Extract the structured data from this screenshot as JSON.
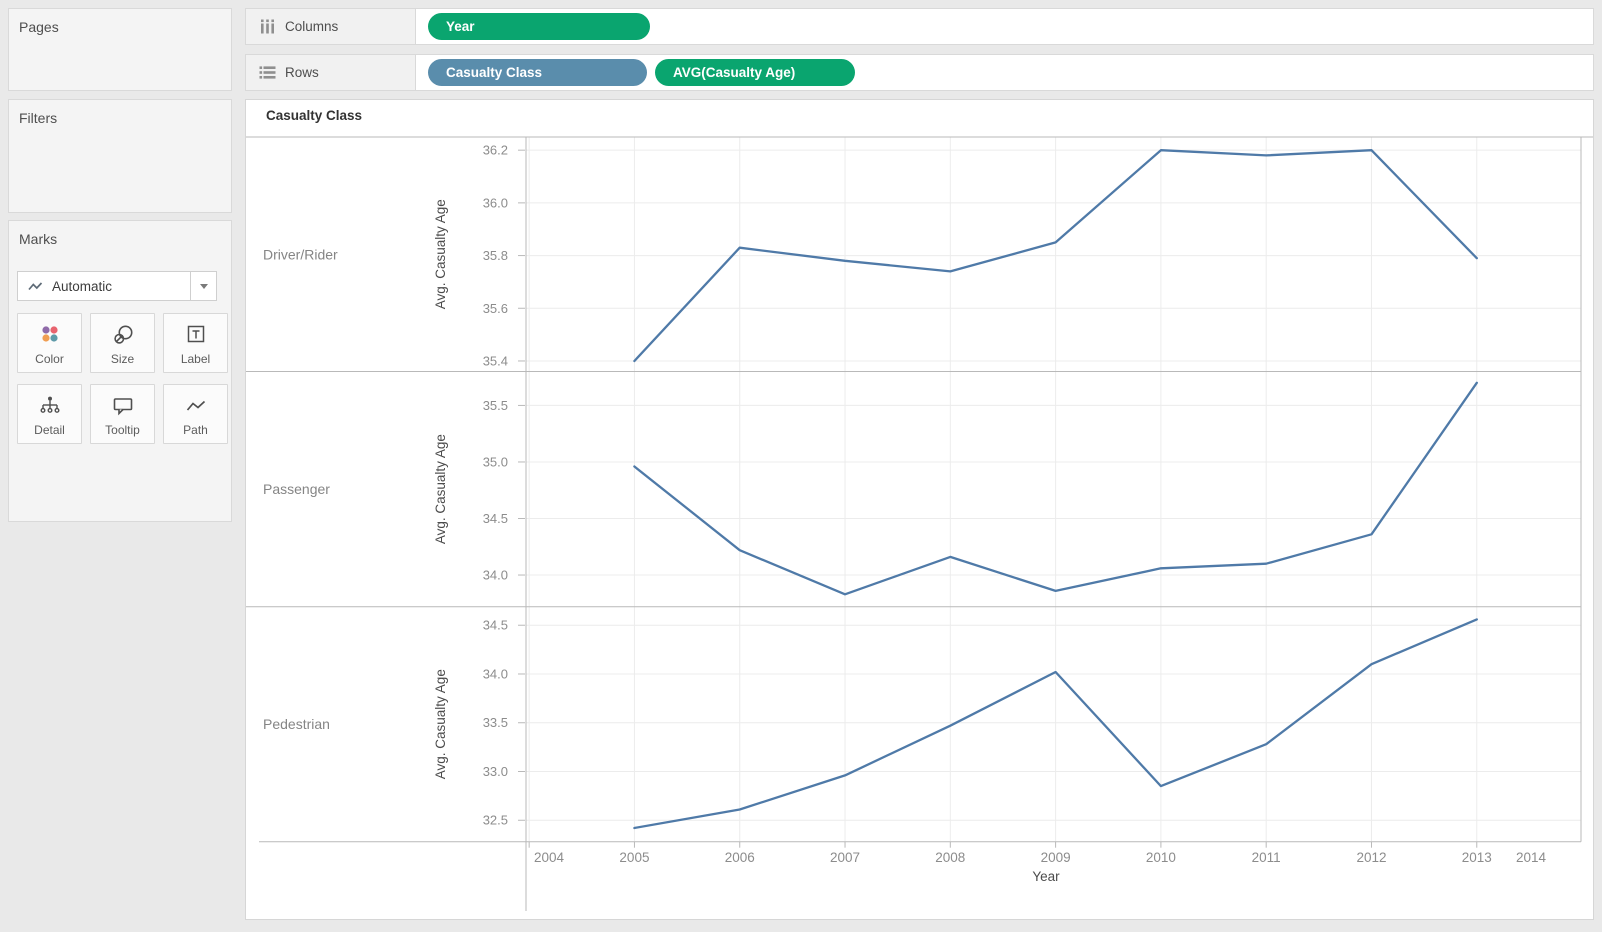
{
  "sidebar": {
    "pages": {
      "title": "Pages"
    },
    "filters": {
      "title": "Filters"
    },
    "marks": {
      "title": "Marks",
      "mark_type": {
        "label": "Automatic"
      },
      "buttons": [
        {
          "label": "Color"
        },
        {
          "label": "Size"
        },
        {
          "label": "Label"
        },
        {
          "label": "Detail"
        },
        {
          "label": "Tooltip"
        },
        {
          "label": "Path"
        }
      ],
      "color_icon_swatches": [
        "#8f6aa9",
        "#e8636e",
        "#f09e52",
        "#5e9aa8"
      ]
    }
  },
  "shelves": {
    "columns": {
      "label": "Columns",
      "pills": [
        {
          "text": "Year",
          "color": "#0aa56f"
        }
      ]
    },
    "rows": {
      "label": "Rows",
      "pills": [
        {
          "text": "Casualty Class",
          "color": "#5a8dac"
        },
        {
          "text": "AVG(Casualty Age)",
          "color": "#0aa56f"
        }
      ]
    }
  },
  "sheet": {
    "header": "Casualty Class"
  },
  "chart_data": {
    "type": "line",
    "title": "Casualty Class",
    "x": [
      2005,
      2006,
      2007,
      2008,
      2009,
      2010,
      2011,
      2012,
      2013
    ],
    "xlabel": "Year",
    "x_axis": {
      "lim": [
        2003.97,
        2013.99
      ],
      "ticks": [
        2004,
        2005,
        2006,
        2007,
        2008,
        2009,
        2010,
        2011,
        2012,
        2013,
        2014
      ]
    },
    "line_color": "#4f7aa8",
    "grid": true,
    "legend": "none",
    "panes": [
      {
        "row_label": "Driver/Rider",
        "ylabel": "Avg. Casualty Age",
        "ylim": [
          35.36,
          36.25
        ],
        "yticks": [
          35.4,
          35.6,
          35.8,
          36.0,
          36.2
        ],
        "values": [
          35.4,
          35.83,
          35.78,
          35.74,
          35.85,
          36.2,
          36.18,
          36.2,
          35.79
        ]
      },
      {
        "row_label": "Passenger",
        "ylabel": "Avg. Casualty Age",
        "ylim": [
          33.72,
          35.8
        ],
        "yticks": [
          34.0,
          34.5,
          35.0,
          35.5
        ],
        "values": [
          34.96,
          34.22,
          33.83,
          34.16,
          33.86,
          34.06,
          34.1,
          34.36,
          35.7
        ]
      },
      {
        "row_label": "Pedestrian",
        "ylabel": "Avg. Casualty Age",
        "ylim": [
          32.28,
          34.69
        ],
        "yticks": [
          32.5,
          33.0,
          33.5,
          34.0,
          34.5
        ],
        "values": [
          32.42,
          32.61,
          32.96,
          33.47,
          34.02,
          32.85,
          33.28,
          34.1,
          34.56
        ]
      }
    ]
  }
}
